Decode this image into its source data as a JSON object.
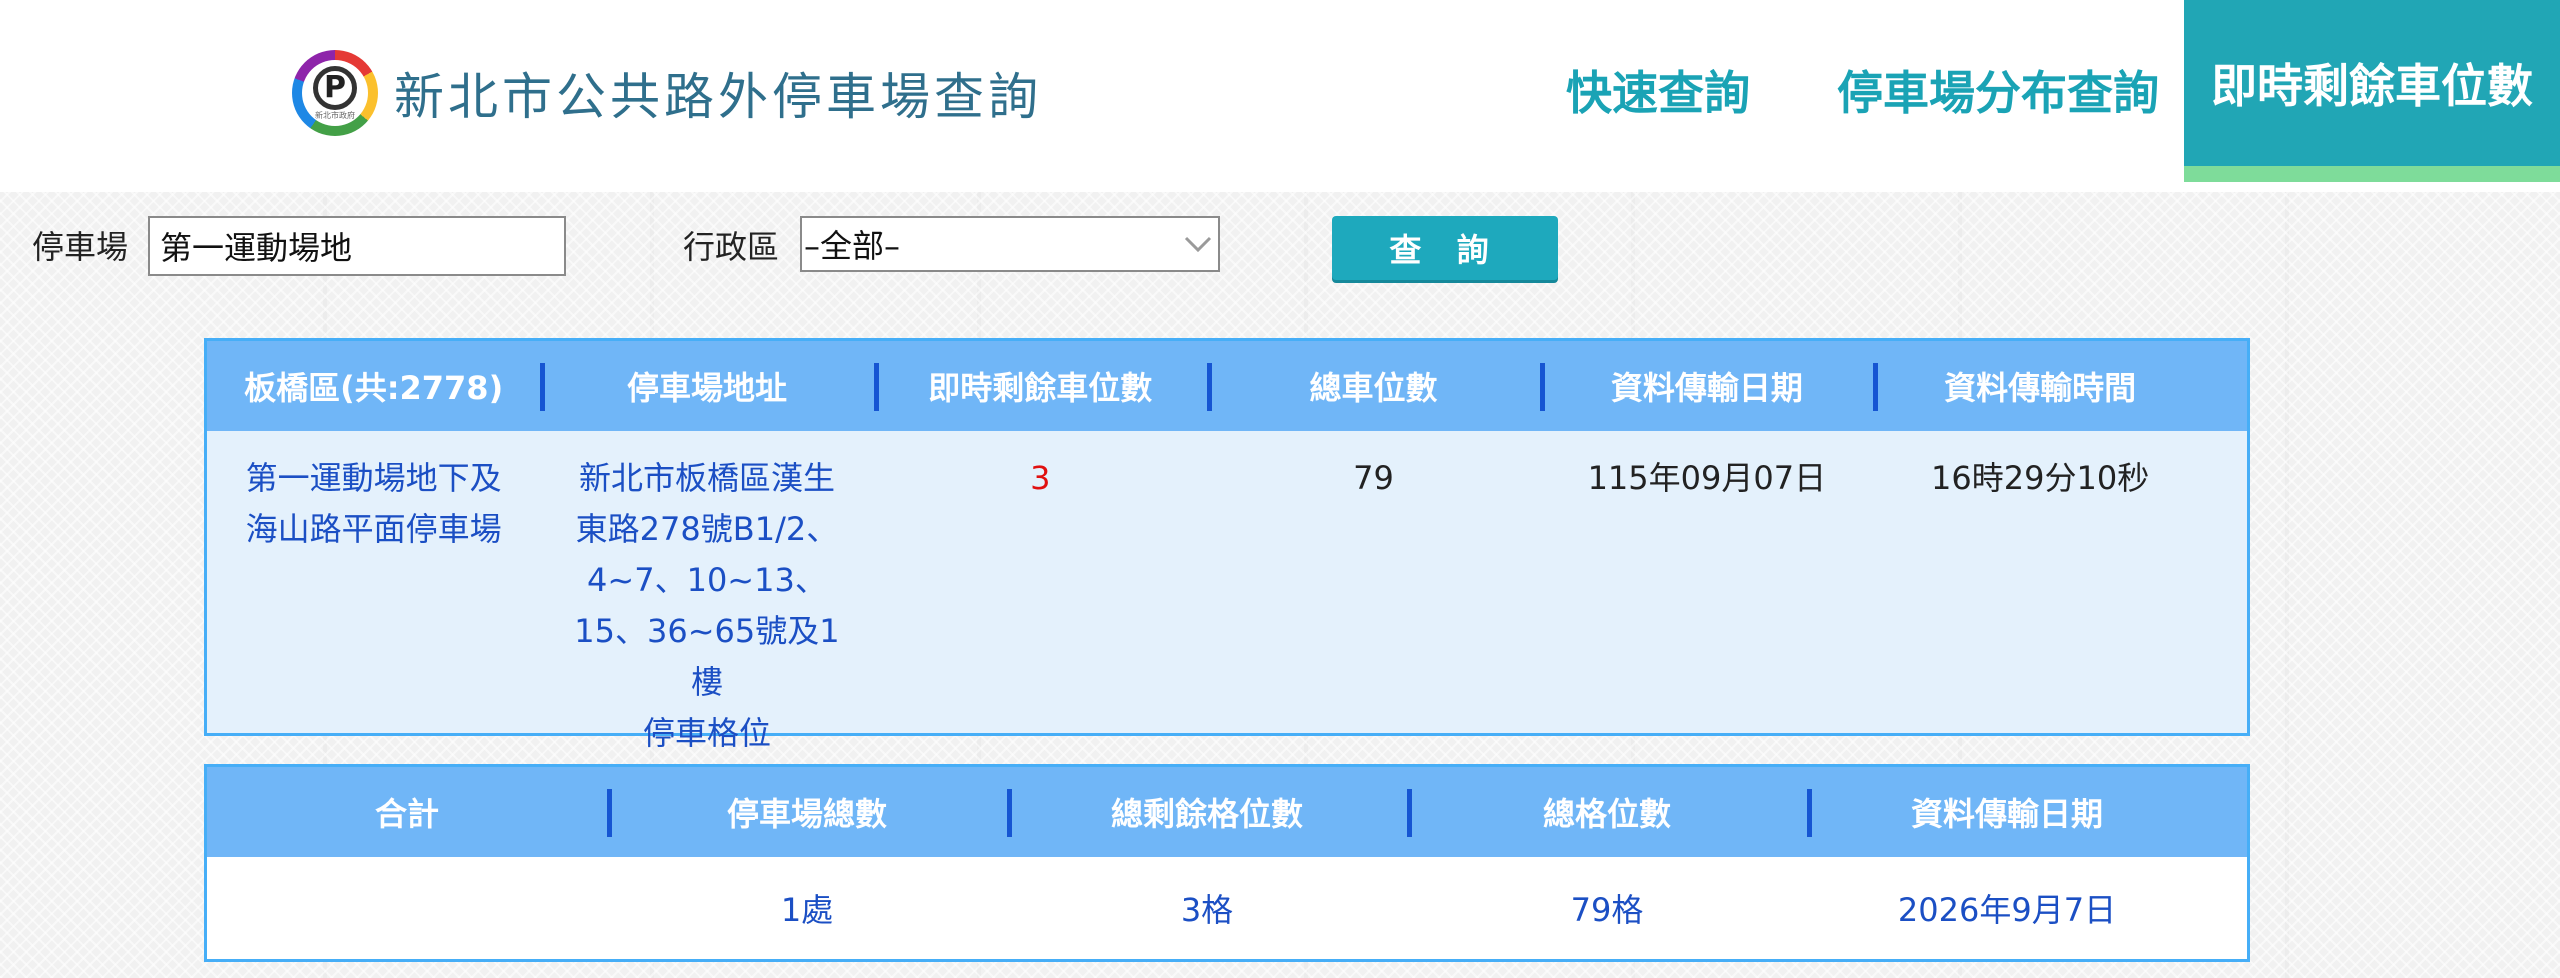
{
  "header": {
    "logo_icon": "parking-p-logo",
    "logo_text": "新北市政府",
    "title": "新北市公共路外停車場查詢",
    "nav": {
      "quick": "快速查詢",
      "distribution": "停車場分布查詢",
      "live": "即時剩餘車位數"
    },
    "colors": {
      "nav_text": "#1aa3b5",
      "active_bg": "#21a6b5",
      "active_underline": "#7edc9a",
      "title": "#2f6f8c"
    }
  },
  "search": {
    "lot_label": "停車場",
    "lot_value": "第一運動場地",
    "district_label": "行政區",
    "district_value": "–全部–",
    "button_label": "查 詢",
    "button_color": "#1ea9bd"
  },
  "detail_table": {
    "headers": [
      "板橋區(共:2778)",
      "停車場地址",
      "即時剩餘車位數",
      "總車位數",
      "資料傳輸日期",
      "資料傳輸時間"
    ],
    "row": {
      "name_line1": "第一運動場地下及",
      "name_line2": "海山路平面停車場",
      "address_lines": [
        "新北市板橋區漢生",
        "東路278號B1/2、",
        "4~7、10~13、",
        "15、36~65號及1樓",
        "停車格位"
      ],
      "available": "3",
      "total": "79",
      "date": "115年09月07日",
      "time": "16時29分10秒"
    },
    "colors": {
      "header_bg": "#70b6f7",
      "border": "#46aef7",
      "divider": "#1655d2",
      "row_bg": "#e4f1fc",
      "available": "#e01010",
      "link": "#1b4fc4"
    }
  },
  "summary_table": {
    "headers": [
      "合計",
      "停車場總數",
      "總剩餘格位數",
      "總格位數",
      "資料傳輸日期"
    ],
    "row": {
      "label": "",
      "lot_count": "1處",
      "available_total": "3格",
      "total_spaces": "79格",
      "date": "2026年9月7日"
    }
  }
}
